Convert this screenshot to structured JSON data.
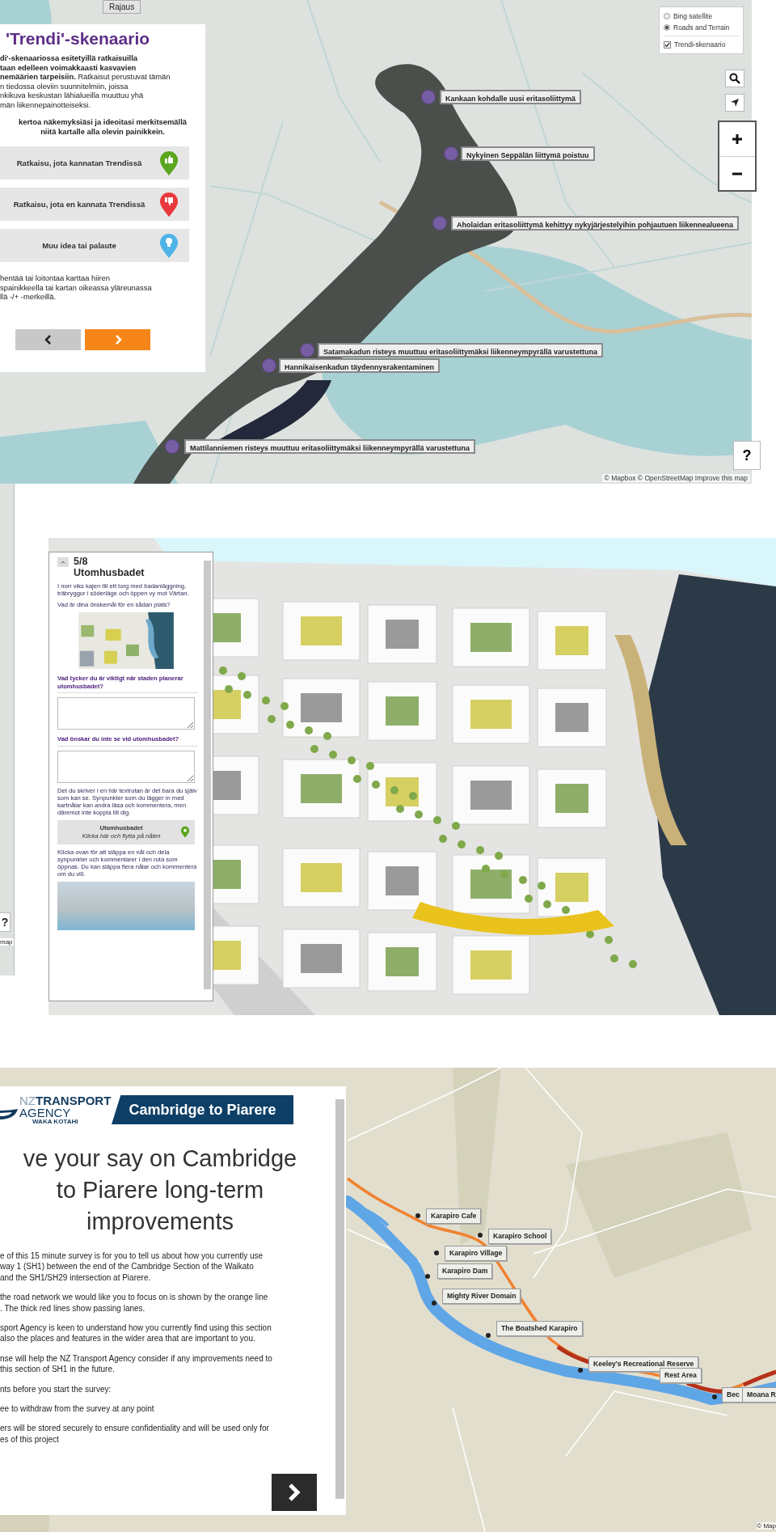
{
  "trend_map": {
    "filter_button": "Rajaus",
    "panel": {
      "title": "'Trendi'-skenaario",
      "intro_lines": [
        "**di'-skenaariossa esitetyillä ratkaisuilla**",
        "**taan edelleen voimakkaasti kasvavien**",
        "**nemäärien tarpeisiin.** Ratkaisut perustuvat tämän",
        "n tiedossa oleviin suunnitelmiin, joissa",
        "nkikuva keskustan lähialueilla muuttuu yhä",
        "män liikennepainotteiseksi."
      ],
      "prompt_lines": [
        "kertoa näkemyksiäsi ja ideoitasi merkitsemällä",
        "niitä kartalle alla olevin painikkein."
      ],
      "pin_buttons": [
        {
          "label": "Ratkaisu, jota kannatan Trendissä",
          "kind": "support",
          "color": "#5aa61e"
        },
        {
          "label": "Ratkaisu, jota en kannata Trendissä",
          "kind": "oppose",
          "color": "#e8383d"
        },
        {
          "label": "Muu idea tai palaute",
          "kind": "idea",
          "color": "#4fb3e8"
        }
      ],
      "hint_lines": [
        "hentää tai loitontaa karttaa hiiren",
        "spainikkeella tai kartan oikeassa yläreunassa",
        "llä -/+ -merkeillä."
      ]
    },
    "layers": [
      {
        "label": "Bing satellite",
        "kind": "radio",
        "selected": false
      },
      {
        "label": "Roads and Terrain",
        "kind": "radio",
        "selected": true
      },
      {
        "label": "Trendi-skenaario",
        "kind": "checkbox",
        "checked": true
      }
    ],
    "markers": [
      "Kankaan kohdalle uusi eritasoliittymä",
      "Nykyinen Seppälän liittymä poistuu",
      "Aholaidan eritasoliittymä kehittyy nykyjärjestelyihin pohjautuen liikennealueena",
      "Satamakadun risteys muuttuu eritasoliittymäksi liikenneympyrällä varustettuna",
      "Hannikaisenkadun täydennysrakentaminen",
      "Mattilanniemen risteys muuttuu eritasoliittymäksi liikenneympyrällä varustettuna"
    ],
    "help": "?",
    "attribution": "© Mapbox © OpenStreetMap Improve this map"
  },
  "edge_map": {
    "help": "?",
    "attribution": "map"
  },
  "plan_view": {
    "step": "5/8",
    "title": "Utomhusbadet",
    "intro": "I norr viks kajen till ett torg med badanläggning, träbryggor i söderläge och öppen vy mot Värtan.",
    "question": "Vad är dina önskemål för en sådan plats?",
    "fields": [
      {
        "label": "Vad tycker du är viktigt när staden planerar utomhusbadet?"
      },
      {
        "label": "Vad önskar du inte se vid utomhusbadet?"
      }
    ],
    "privacy_note": "Det du skriver i en här textrutan är det bara du själv som kan se. Synpunkter som du lägger in med kartnålar kan andra läsa och kommentera, men däremot inte koppla till dig.",
    "pin_button": {
      "title": "Utomhusbadet",
      "hint": "Klicka här och flytta på nålen",
      "color": "#5aa61e"
    },
    "pin_note": "Klicka ovan för att släppa en nål och dela synpunkter och kommentarer i den ruta som öppnas. Du kan släppa flera nålar och kommentera om du vill."
  },
  "survey_map": {
    "logo": {
      "nz": "NZ",
      "line1": "TRANSPORT",
      "line2": "AGENCY",
      "line3": "WAKA KOTAHI"
    },
    "banner": "Cambridge to Piarere",
    "heading_lines": [
      "ve your say on Cambridge",
      "to Piarere long-term",
      "improvements"
    ],
    "paragraphs": [
      [
        "e of this 15 minute survey is for you to tell us about how you currently use",
        "way 1 (SH1) between the end of the Cambridge Section of the Waikato",
        " and the SH1/SH29 intersection at Piarere."
      ],
      [
        "the road network we would like you to focus on is shown by the orange line",
        ". The thick red lines show passing lanes."
      ],
      [
        "sport Agency is keen to understand how you currently find using this section",
        "also the places and features in the wider area that are important to you."
      ],
      [
        "nse will help the NZ Transport Agency consider if any improvements need to",
        "this section of SH1 in the future."
      ],
      [
        "nts before you start the survey:"
      ],
      [
        "ee to withdraw from the survey at any point"
      ],
      [
        "ers will be stored securely to ensure confidentiality and will be used only for",
        "es of this project"
      ]
    ],
    "places": [
      "Karapiro Cafe",
      "Karapiro School",
      "Karapiro Village",
      "Karapiro Dam",
      "Mighty River Domain",
      "The Boatshed Karapiro",
      "Keeley's Recreational Reserve",
      "Rest Area",
      "Bec",
      "Moana R"
    ],
    "attribution": "© Map"
  }
}
